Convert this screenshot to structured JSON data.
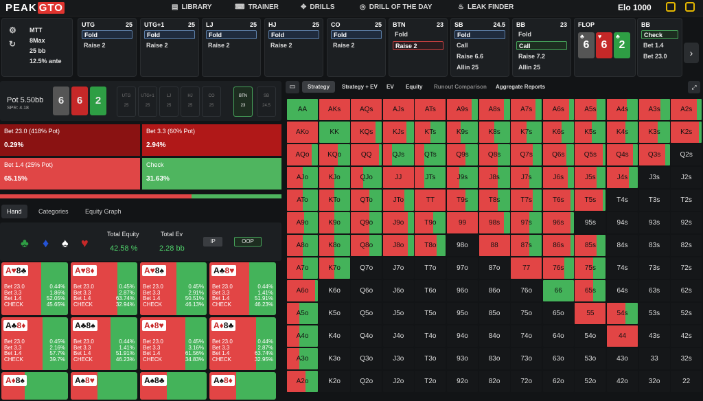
{
  "nav": {
    "logo_a": "PEAK",
    "logo_b": "GTO",
    "items": [
      {
        "icon": "book",
        "label": "LIBRARY"
      },
      {
        "icon": "gamepad",
        "label": "TRAINER"
      },
      {
        "icon": "dice",
        "label": "DRILLS"
      },
      {
        "icon": "target",
        "label": "DRILL OF THE DAY"
      },
      {
        "icon": "flame",
        "label": "LEAK FINDER"
      }
    ],
    "elo": "Elo 1000"
  },
  "game": {
    "type": "MTT",
    "table": "8Max",
    "stack": "25 bb",
    "ante": "12.5% ante"
  },
  "positions": [
    {
      "name": "UTG",
      "stack": "25",
      "opts": [
        "Fold",
        "Raise 2"
      ],
      "sel": 0,
      "selc": "b"
    },
    {
      "name": "UTG+1",
      "stack": "25",
      "opts": [
        "Fold",
        "Raise 2"
      ],
      "sel": 0,
      "selc": "b"
    },
    {
      "name": "LJ",
      "stack": "25",
      "opts": [
        "Fold",
        "Raise 2"
      ],
      "sel": 0,
      "selc": "b"
    },
    {
      "name": "HJ",
      "stack": "25",
      "opts": [
        "Fold",
        "Raise 2"
      ],
      "sel": 0,
      "selc": "b"
    },
    {
      "name": "CO",
      "stack": "25",
      "opts": [
        "Fold",
        "Raise 2"
      ],
      "sel": 0,
      "selc": "b"
    },
    {
      "name": "BTN",
      "stack": "23",
      "opts": [
        "Fold",
        "Raise 2"
      ],
      "sel": 1,
      "selc": "r"
    },
    {
      "name": "SB",
      "stack": "24.5",
      "opts": [
        "Fold",
        "Call",
        "Raise 6.6",
        "Allin 25"
      ],
      "sel": 0,
      "selc": "b"
    },
    {
      "name": "BB",
      "stack": "23",
      "opts": [
        "Fold",
        "Call",
        "Raise 7.2",
        "Allin 25"
      ],
      "sel": 1,
      "selc": "g"
    }
  ],
  "flop": {
    "name": "FLOP",
    "cards": [
      {
        "rank": "6",
        "suit": "♣"
      },
      {
        "rank": "6",
        "suit": "♥"
      },
      {
        "rank": "2",
        "suit": "♣"
      }
    ]
  },
  "bb_node": {
    "name": "BB",
    "opts": [
      "Check",
      "Bet 1.4",
      "Bet 23.0"
    ]
  },
  "pot": {
    "label": "Pot",
    "value": "5.50bb",
    "spr": "SPR: 4.18"
  },
  "mini_pos": [
    {
      "n": "UTG",
      "v": "25"
    },
    {
      "n": "UTG+1",
      "v": "25"
    },
    {
      "n": "LJ",
      "v": "25"
    },
    {
      "n": "HJ",
      "v": "25"
    },
    {
      "n": "CO",
      "v": "25"
    },
    {
      "n": "BTN",
      "v": "23"
    },
    {
      "n": "SB",
      "v": "24.5"
    }
  ],
  "actions": [
    {
      "label": "Bet 23.0 (418% Pot)",
      "pct": "0.29%"
    },
    {
      "label": "Bet 3.3 (60% Pot)",
      "pct": "2.94%"
    },
    {
      "label": "Bet 1.4 (25% Pot)",
      "pct": "65.15%"
    },
    {
      "label": "Check",
      "pct": "31.63%"
    }
  ],
  "tabs": [
    "Hand",
    "Categories",
    "Equity Graph"
  ],
  "equity": {
    "total_equity_label": "Total Equity",
    "total_equity": "42.58 %",
    "total_ev_label": "Total Ev",
    "total_ev": "2.28 bb",
    "ip": "IP",
    "oop": "OOP"
  },
  "suits": [
    "♣",
    "♦",
    "♠",
    "♥"
  ],
  "hand_rows": [
    "Bet 23.0",
    "Bet 3.3",
    "Bet 1.4",
    "CHECK"
  ],
  "hands": [
    {
      "card1": "A♥",
      "card2": "8♣",
      "v": [
        "0.44%",
        "1.86%",
        "52.05%",
        "45.65%"
      ],
      "red": 0.6
    },
    {
      "card1": "A♥",
      "card2": "8♦",
      "v": [
        "0.45%",
        "2.87%",
        "63.74%",
        "32.94%"
      ],
      "red": 0.7
    },
    {
      "card1": "A♥",
      "card2": "8♠",
      "v": [
        "0.45%",
        "2.91%",
        "50.51%",
        "46.13%"
      ],
      "red": 0.55
    },
    {
      "card1": "A♣",
      "card2": "8♥",
      "v": [
        "0.44%",
        "1.41%",
        "51.91%",
        "46.23%"
      ],
      "red": 0.6
    },
    {
      "card1": "A♣",
      "card2": "8♦",
      "v": [
        "0.45%",
        "2.16%",
        "57.7%",
        "39.7%"
      ],
      "red": 0.62
    },
    {
      "card1": "A♣",
      "card2": "8♠",
      "v": [
        "0.44%",
        "1.41%",
        "51.91%",
        "46.23%"
      ],
      "red": 0.6
    },
    {
      "card1": "A♦",
      "card2": "8♥",
      "v": [
        "0.45%",
        "3.16%",
        "61.56%",
        "34.83%"
      ],
      "red": 0.68
    },
    {
      "card1": "A♦",
      "card2": "8♣",
      "v": [
        "0.44%",
        "2.87%",
        "63.74%",
        "32.95%"
      ],
      "red": 0.7
    },
    {
      "card1": "A♦",
      "card2": "8♠",
      "v": [],
      "red": 0.35
    },
    {
      "card1": "A♠",
      "card2": "8♥",
      "v": [],
      "red": 0.4
    },
    {
      "card1": "A♠",
      "card2": "8♣",
      "v": [],
      "red": 0.4
    },
    {
      "card1": "A♠",
      "card2": "8♦",
      "v": [],
      "red": 0.4
    }
  ],
  "grid_tabs": [
    "Strategy",
    "Strategy + EV",
    "EV",
    "Equity",
    "Runout Comparison",
    "Aggregate Reports"
  ],
  "colors": {
    "red": "#e24545",
    "green": "#44b35a",
    "dark": "#151719"
  },
  "grid": [
    [
      "AA:0:1",
      "AKs:1",
      "AQs:1",
      "AJs:1",
      "ATs:1",
      "A9s:0.8",
      "A8s:0.8",
      "A7s:0.8",
      "A6s:0.85",
      "A5s:0.7",
      "A4s:0.65",
      "A3s:0.7",
      "A2s:0.85"
    ],
    [
      "AKo:1",
      "KK:0:1",
      "KQs:0.8",
      "KJs:0.75",
      "KTs:0.5",
      "K9s:0.45",
      "K8s:0.5",
      "K7s:0.5",
      "K6s:0.6",
      "K5s:0.55",
      "K4s:0.6",
      "K3s:0.6",
      "K2s:0.9"
    ],
    [
      "AQo:0.8",
      "KQo:0.6",
      "QQ:0.9",
      "QJs:0.3",
      "QTs:0.3",
      "Q9s:0.6",
      "Q8s:0.6",
      "Q7s:0.7",
      "Q6s:0.75",
      "Q5s:0.9",
      "Q4s:0.85",
      "Q3s:0.85",
      "Q2s:d"
    ],
    [
      "AJo:0.5",
      "KJo:0.5",
      "QJo:0.4",
      "JJ:1",
      "JTs:0.3",
      "J9s:0.4",
      "J8s:0.6",
      "J7s:0.6",
      "J6s:0.8",
      "J5s:0.7",
      "J4s:0.7",
      "J3s:d",
      "J2s:d"
    ],
    [
      "ATo:0.5",
      "KTo:0.5",
      "QTo:0.6",
      "JTo:0.7",
      "TT:1",
      "T9s:0.6",
      "T8s:0.6",
      "T7s:0.7",
      "T6s:0.9",
      "T5s:0.9",
      "T4s:d",
      "T3s:d",
      "T2s:d"
    ],
    [
      "A9o:0.55",
      "K9o:0.5",
      "Q9o:0.6",
      "J9o:0.8",
      "T9o:0.6",
      "99:1",
      "98s:0.8",
      "97s:0.6",
      "96s:0.9",
      "95s:d",
      "94s:d",
      "93s:d",
      "92s:d"
    ],
    [
      "A8o:0.5",
      "K8o:0.5",
      "Q8o:0.6",
      "J8o:0.8",
      "T8o:0.7",
      "98o:d",
      "88:1",
      "87s:0.6",
      "86s:0.9",
      "85s:0.7",
      "84s:d",
      "83s:d",
      "82s:d"
    ],
    [
      "A7o:0.5",
      "K7o:0.5",
      "Q7o:d",
      "J7o:d",
      "T7o:d",
      "97o:d",
      "87o:d",
      "77:1",
      "76s:0.7",
      "75s:0.6",
      "74s:d",
      "73s:d",
      "72s:d"
    ],
    [
      "A6o:0.9",
      "K6o:d",
      "Q6o:d",
      "J6o:d",
      "T6o:d",
      "96o:d",
      "86o:d",
      "76o:d",
      "66:0:1",
      "65s:0.6",
      "64s:d",
      "63s:d",
      "62s:d"
    ],
    [
      "A5o:0.4",
      "K5o:d",
      "Q5o:d",
      "J5o:d",
      "T5o:d",
      "95o:d",
      "85o:d",
      "75o:d",
      "65o:d",
      "55:1",
      "54s:0.6",
      "53s:d",
      "52s:d"
    ],
    [
      "A4o:0.4",
      "K4o:d",
      "Q4o:d",
      "J4o:d",
      "T4o:d",
      "94o:d",
      "84o:d",
      "74o:d",
      "64o:d",
      "54o:d",
      "44:1",
      "43s:d",
      "42s:d"
    ],
    [
      "A3o:0.4",
      "K3o:d",
      "Q3o:d",
      "J3o:d",
      "T3o:d",
      "93o:d",
      "83o:d",
      "73o:d",
      "63o:d",
      "53o:d",
      "43o:d",
      "33:d",
      "32s:d"
    ],
    [
      "A2o:0.6",
      "K2o:d",
      "Q2o:d",
      "J2o:d",
      "T2o:d",
      "92o:d",
      "82o:d",
      "72o:d",
      "62o:d",
      "52o:d",
      "42o:d",
      "32o:d",
      "22:d"
    ]
  ]
}
